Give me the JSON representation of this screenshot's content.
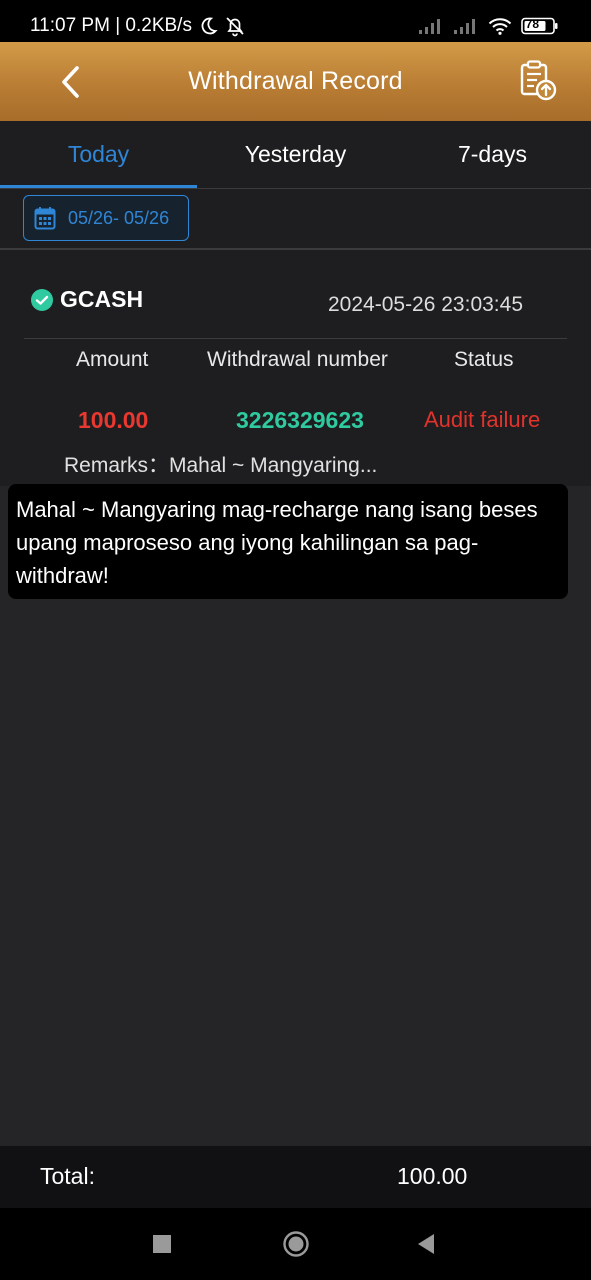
{
  "status_bar": {
    "time_speed": "11:07 PM | 0.2KB/s",
    "battery": "78",
    "icons": [
      "moon-icon",
      "bell-off-icon",
      "signal-icon",
      "signal-icon",
      "wifi-icon",
      "battery-icon"
    ]
  },
  "header": {
    "title": "Withdrawal Record",
    "icons": [
      "back-arrow-icon",
      "clipboard-upload-icon"
    ]
  },
  "tabs": [
    {
      "label": "Today",
      "active": true
    },
    {
      "label": "Yesterday",
      "active": false
    },
    {
      "label": "7-days",
      "active": false
    }
  ],
  "filter": {
    "date_range": "05/26- 05/26",
    "icon": "calendar-icon"
  },
  "record": {
    "provider": "GCASH",
    "provider_icon": "gcash-logo-icon",
    "datetime": "2024-05-26 23:03:45",
    "columns": {
      "amount": "Amount",
      "number": "Withdrawal number",
      "status": "Status"
    },
    "values": {
      "amount": "100.00",
      "number": "3226329623",
      "status": "Audit failure"
    },
    "remarks": "Remarks：Mahal ~ Mangyaring..."
  },
  "tooltip": {
    "text": "Mahal ~ Mangyaring mag-recharge nang isang beses upang maproseso ang iyong kahilingan sa pag-withdraw!"
  },
  "total": {
    "label": "Total:",
    "value": "100.00"
  },
  "nav": {
    "icons": [
      "square-recents-icon",
      "circle-home-icon",
      "triangle-back-icon"
    ]
  },
  "colors": {
    "accent_blue": "#2f86d6",
    "header_gold": "#c28838",
    "amount_red": "#e8382f",
    "number_green": "#2fcaa0",
    "status_red": "#e0332c"
  }
}
